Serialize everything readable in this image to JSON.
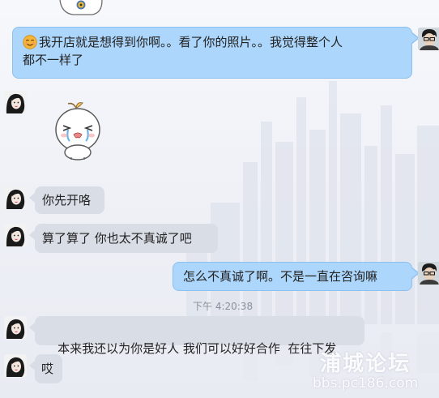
{
  "messages": [
    {
      "sender": "me",
      "type": "text",
      "emoji": "smiley-emoji",
      "text_line1": "我开店就是想得到你啊。。看了你的照片。。我觉得整个人",
      "text_line2": "都不一样了"
    },
    {
      "sender": "contact",
      "type": "sticker",
      "sticker": "crying-bun-sticker"
    },
    {
      "sender": "contact",
      "type": "text",
      "text": "你先开咯"
    },
    {
      "sender": "contact",
      "type": "text",
      "text": "算了算了 你也太不真诚了吧"
    },
    {
      "sender": "me",
      "type": "text",
      "text": "怎么不真诚了啊。不是一直在咨询嘛"
    },
    {
      "type": "timestamp",
      "text": "下午 4:20:38"
    },
    {
      "sender": "contact",
      "type": "text",
      "text": "本来我还以为你是好人 我们可以好好合作  在往下发"
    },
    {
      "sender": "contact",
      "type": "text",
      "text": "哎"
    }
  ],
  "watermark": {
    "title": "浦城论坛",
    "url": "bbs.pc186.com"
  },
  "colors": {
    "my_bubble": "#acd6fb",
    "my_bubble_border": "#8cc1ef",
    "their_bubble": "#d9dde6",
    "background": "#f2f3f8"
  }
}
